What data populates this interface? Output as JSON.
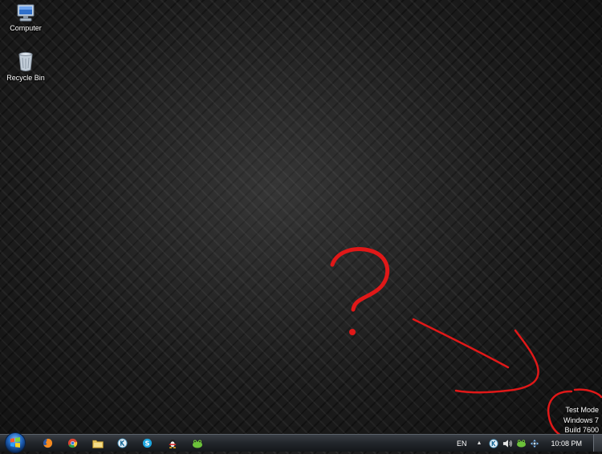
{
  "desktop": {
    "icons": [
      {
        "label": "Computer",
        "icon": "computer-icon"
      },
      {
        "label": "Recycle Bin",
        "icon": "recycle-bin-icon"
      }
    ],
    "watermark": {
      "line1": "Test Mode",
      "line2": "Windows 7",
      "line3": "Build 7600"
    },
    "annotation": {
      "color": "#e01818",
      "shapes": [
        "question-mark",
        "arrow",
        "circle"
      ]
    }
  },
  "taskbar": {
    "start": "windows-start-orb",
    "pinned": [
      "firefox-icon",
      "chrome-icon",
      "explorer-folder-icon",
      "kaspersky-icon",
      "skype-icon",
      "qq-penguin-icon",
      "frog-app-icon"
    ],
    "tray": {
      "language": "EN",
      "clock": "10:08 PM",
      "icons": [
        "show-hidden-icon",
        "kaspersky-tray-icon",
        "volume-icon",
        "frog-tray-icon",
        "network-icon"
      ]
    }
  },
  "colors": {
    "desktop_bg": "#1c1c1c",
    "taskbar": "#23272c",
    "annotation": "#e01818"
  }
}
